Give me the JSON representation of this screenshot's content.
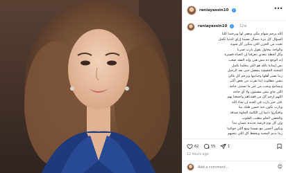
{
  "post": {
    "username": "raniayassin10",
    "verified_icon": "verified-badge-icon",
    "more_label": "•••",
    "time_ago": "12w",
    "timestamp": "12 hours ago",
    "likes_count": "62",
    "comments_count": "55",
    "share_count": "1",
    "caption_lines": [
      "الله يرحم سهام مكي ويغفر لها ويرحمنا كلنا",
      "السؤال كل مرة بنسأل نفسنا إزاي الدنيا تكمل",
      "تعبت من الحزن اللي بيتكرر كل شوية",
      "والواحد بيحاول يقول يارب صبرنا",
      "وكل لحظة بتعدي بتعرفنا إن الحياة قصيرة",
      "إنه الوجع ده مش هين وإنه الفقد صعب",
      "بس إيماننا بالله هو اللي بيخلينا نكمل",
      "المحبة الحقيقية بتفضل حتى بعد الرحيل",
      "ربنا يصبر أهلها وحبايبها ويرحم كل غالي",
      "نيفين مطلوب إننا نقرب من بعض أكتر",
      "ونسامح ونحب من غير ما نستنى حاجة",
      "اللي جاي مش مضمون ولا أي حاجة",
      "اللهم ارحم كل من فقدناهم واجمعنا بهم",
      "على خير يارب في الجنة إن شاء الله",
      "ويارب نكون عند حسن ظنك بينا",
      "وافتكروا دايما إن الكلمة الحلوة صدقة",
      "والحضن الحلو بيطيب القلوب",
      "وإن كل يوم فرصة جديدة عشان نبدأ",
      "ونكون أحسن مع نفسنا ومع اللي حوالينا",
      "ربنا يديم المحبة ويحفظ كل اللي بنحبهم"
    ]
  },
  "comment_box": {
    "placeholder": "Add a comment...",
    "emoji_label": "☺"
  },
  "colors": {
    "verified": "#3897f0",
    "text": "#262626",
    "muted": "#8e8e8e",
    "divider": "#efefef"
  }
}
